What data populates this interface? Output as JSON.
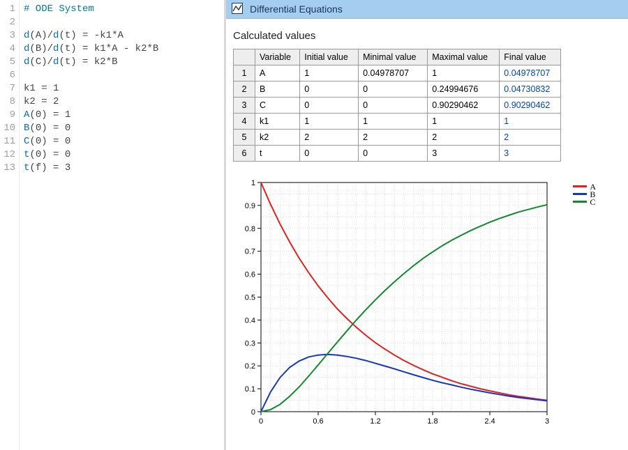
{
  "editor": {
    "lines": [
      {
        "n": 1,
        "tokens": [
          {
            "c": "tok-comment",
            "t": "# ODE System"
          }
        ]
      },
      {
        "n": 2,
        "tokens": []
      },
      {
        "n": 3,
        "tokens": [
          {
            "c": "tok-func",
            "t": "d"
          },
          {
            "c": "tok-op",
            "t": "("
          },
          {
            "c": "tok-var",
            "t": "A"
          },
          {
            "c": "tok-op",
            "t": ")"
          },
          {
            "c": "tok-op",
            "t": "/"
          },
          {
            "c": "tok-func",
            "t": "d"
          },
          {
            "c": "tok-op",
            "t": "("
          },
          {
            "c": "tok-var",
            "t": "t"
          },
          {
            "c": "tok-op",
            "t": ")"
          },
          {
            "c": "tok-op",
            "t": " = "
          },
          {
            "c": "tok-var",
            "t": "-k1*A"
          }
        ]
      },
      {
        "n": 4,
        "tokens": [
          {
            "c": "tok-func",
            "t": "d"
          },
          {
            "c": "tok-op",
            "t": "("
          },
          {
            "c": "tok-var",
            "t": "B"
          },
          {
            "c": "tok-op",
            "t": ")"
          },
          {
            "c": "tok-op",
            "t": "/"
          },
          {
            "c": "tok-func",
            "t": "d"
          },
          {
            "c": "tok-op",
            "t": "("
          },
          {
            "c": "tok-var",
            "t": "t"
          },
          {
            "c": "tok-op",
            "t": ")"
          },
          {
            "c": "tok-op",
            "t": " = "
          },
          {
            "c": "tok-var",
            "t": "k1*A - k2*B"
          }
        ]
      },
      {
        "n": 5,
        "tokens": [
          {
            "c": "tok-func",
            "t": "d"
          },
          {
            "c": "tok-op",
            "t": "("
          },
          {
            "c": "tok-var",
            "t": "C"
          },
          {
            "c": "tok-op",
            "t": ")"
          },
          {
            "c": "tok-op",
            "t": "/"
          },
          {
            "c": "tok-func",
            "t": "d"
          },
          {
            "c": "tok-op",
            "t": "("
          },
          {
            "c": "tok-var",
            "t": "t"
          },
          {
            "c": "tok-op",
            "t": ")"
          },
          {
            "c": "tok-op",
            "t": " = "
          },
          {
            "c": "tok-var",
            "t": "k2*B"
          }
        ]
      },
      {
        "n": 6,
        "tokens": []
      },
      {
        "n": 7,
        "tokens": [
          {
            "c": "tok-var",
            "t": "k1 = 1"
          }
        ]
      },
      {
        "n": 8,
        "tokens": [
          {
            "c": "tok-var",
            "t": "k2 = 2"
          }
        ]
      },
      {
        "n": 9,
        "tokens": [
          {
            "c": "tok-func",
            "t": "A"
          },
          {
            "c": "tok-op",
            "t": "("
          },
          {
            "c": "tok-num",
            "t": "0"
          },
          {
            "c": "tok-op",
            "t": ")"
          },
          {
            "c": "tok-op",
            "t": " = "
          },
          {
            "c": "tok-num",
            "t": "1"
          }
        ]
      },
      {
        "n": 10,
        "tokens": [
          {
            "c": "tok-func",
            "t": "B"
          },
          {
            "c": "tok-op",
            "t": "("
          },
          {
            "c": "tok-num",
            "t": "0"
          },
          {
            "c": "tok-op",
            "t": ")"
          },
          {
            "c": "tok-op",
            "t": " = "
          },
          {
            "c": "tok-num",
            "t": "0"
          }
        ]
      },
      {
        "n": 11,
        "tokens": [
          {
            "c": "tok-func",
            "t": "C"
          },
          {
            "c": "tok-op",
            "t": "("
          },
          {
            "c": "tok-num",
            "t": "0"
          },
          {
            "c": "tok-op",
            "t": ")"
          },
          {
            "c": "tok-op",
            "t": " = "
          },
          {
            "c": "tok-num",
            "t": "0"
          }
        ]
      },
      {
        "n": 12,
        "tokens": [
          {
            "c": "tok-func",
            "t": "t"
          },
          {
            "c": "tok-op",
            "t": "("
          },
          {
            "c": "tok-num",
            "t": "0"
          },
          {
            "c": "tok-op",
            "t": ")"
          },
          {
            "c": "tok-op",
            "t": " = "
          },
          {
            "c": "tok-num",
            "t": "0"
          }
        ]
      },
      {
        "n": 13,
        "tokens": [
          {
            "c": "tok-func",
            "t": "t"
          },
          {
            "c": "tok-op",
            "t": "("
          },
          {
            "c": "tok-var",
            "t": "f"
          },
          {
            "c": "tok-op",
            "t": ")"
          },
          {
            "c": "tok-op",
            "t": " = "
          },
          {
            "c": "tok-num",
            "t": "3"
          }
        ]
      }
    ]
  },
  "panel": {
    "title": "Differential Equations",
    "section": "Calculated values"
  },
  "table": {
    "headers": [
      "Variable",
      "Initial value",
      "Minimal value",
      "Maximal value",
      "Final value"
    ],
    "rows": [
      {
        "n": "1",
        "v": "A",
        "init": "1",
        "min": "0.04978707",
        "max": "1",
        "final": "0.04978707"
      },
      {
        "n": "2",
        "v": "B",
        "init": "0",
        "min": "0",
        "max": "0.24994676",
        "final": "0.04730832"
      },
      {
        "n": "3",
        "v": "C",
        "init": "0",
        "min": "0",
        "max": "0.90290462",
        "final": "0.90290462"
      },
      {
        "n": "4",
        "v": "k1",
        "init": "1",
        "min": "1",
        "max": "1",
        "final": "1"
      },
      {
        "n": "5",
        "v": "k2",
        "init": "2",
        "min": "2",
        "max": "2",
        "final": "2"
      },
      {
        "n": "6",
        "v": "t",
        "init": "0",
        "min": "0",
        "max": "3",
        "final": "3"
      }
    ]
  },
  "chart_data": {
    "type": "line",
    "xlim": [
      0,
      3
    ],
    "ylim": [
      0,
      1
    ],
    "xticks": [
      0,
      0.6,
      1.2,
      1.8,
      2.4,
      3
    ],
    "yticks": [
      0,
      0.1,
      0.2,
      0.3,
      0.4,
      0.5,
      0.6,
      0.7,
      0.8,
      0.9,
      1
    ],
    "legend": [
      "A",
      "B",
      "C"
    ],
    "colors": {
      "A": "#e52020",
      "B": "#1535c8",
      "C": "#0f8a2c"
    },
    "x": [
      0,
      0.1,
      0.2,
      0.3,
      0.4,
      0.5,
      0.6,
      0.7,
      0.8,
      0.9,
      1.0,
      1.1,
      1.2,
      1.3,
      1.4,
      1.5,
      1.6,
      1.7,
      1.8,
      1.9,
      2.0,
      2.1,
      2.2,
      2.3,
      2.4,
      2.5,
      2.6,
      2.7,
      2.8,
      2.9,
      3.0
    ],
    "series": [
      {
        "name": "A",
        "values": [
          1.0,
          0.905,
          0.819,
          0.741,
          0.67,
          0.607,
          0.549,
          0.497,
          0.449,
          0.407,
          0.368,
          0.333,
          0.301,
          0.273,
          0.247,
          0.223,
          0.202,
          0.183,
          0.165,
          0.15,
          0.135,
          0.122,
          0.111,
          0.1,
          0.091,
          0.082,
          0.074,
          0.067,
          0.061,
          0.055,
          0.05
        ]
      },
      {
        "name": "B",
        "values": [
          0.0,
          0.086,
          0.149,
          0.193,
          0.221,
          0.239,
          0.247,
          0.25,
          0.247,
          0.241,
          0.233,
          0.223,
          0.211,
          0.199,
          0.187,
          0.174,
          0.161,
          0.149,
          0.137,
          0.126,
          0.117,
          0.107,
          0.098,
          0.09,
          0.082,
          0.075,
          0.068,
          0.062,
          0.057,
          0.052,
          0.047
        ]
      },
      {
        "name": "C",
        "values": [
          0.0,
          0.009,
          0.032,
          0.067,
          0.108,
          0.155,
          0.204,
          0.254,
          0.303,
          0.352,
          0.4,
          0.445,
          0.488,
          0.529,
          0.567,
          0.603,
          0.637,
          0.669,
          0.697,
          0.724,
          0.748,
          0.77,
          0.791,
          0.809,
          0.827,
          0.843,
          0.857,
          0.871,
          0.882,
          0.893,
          0.903
        ]
      }
    ]
  }
}
